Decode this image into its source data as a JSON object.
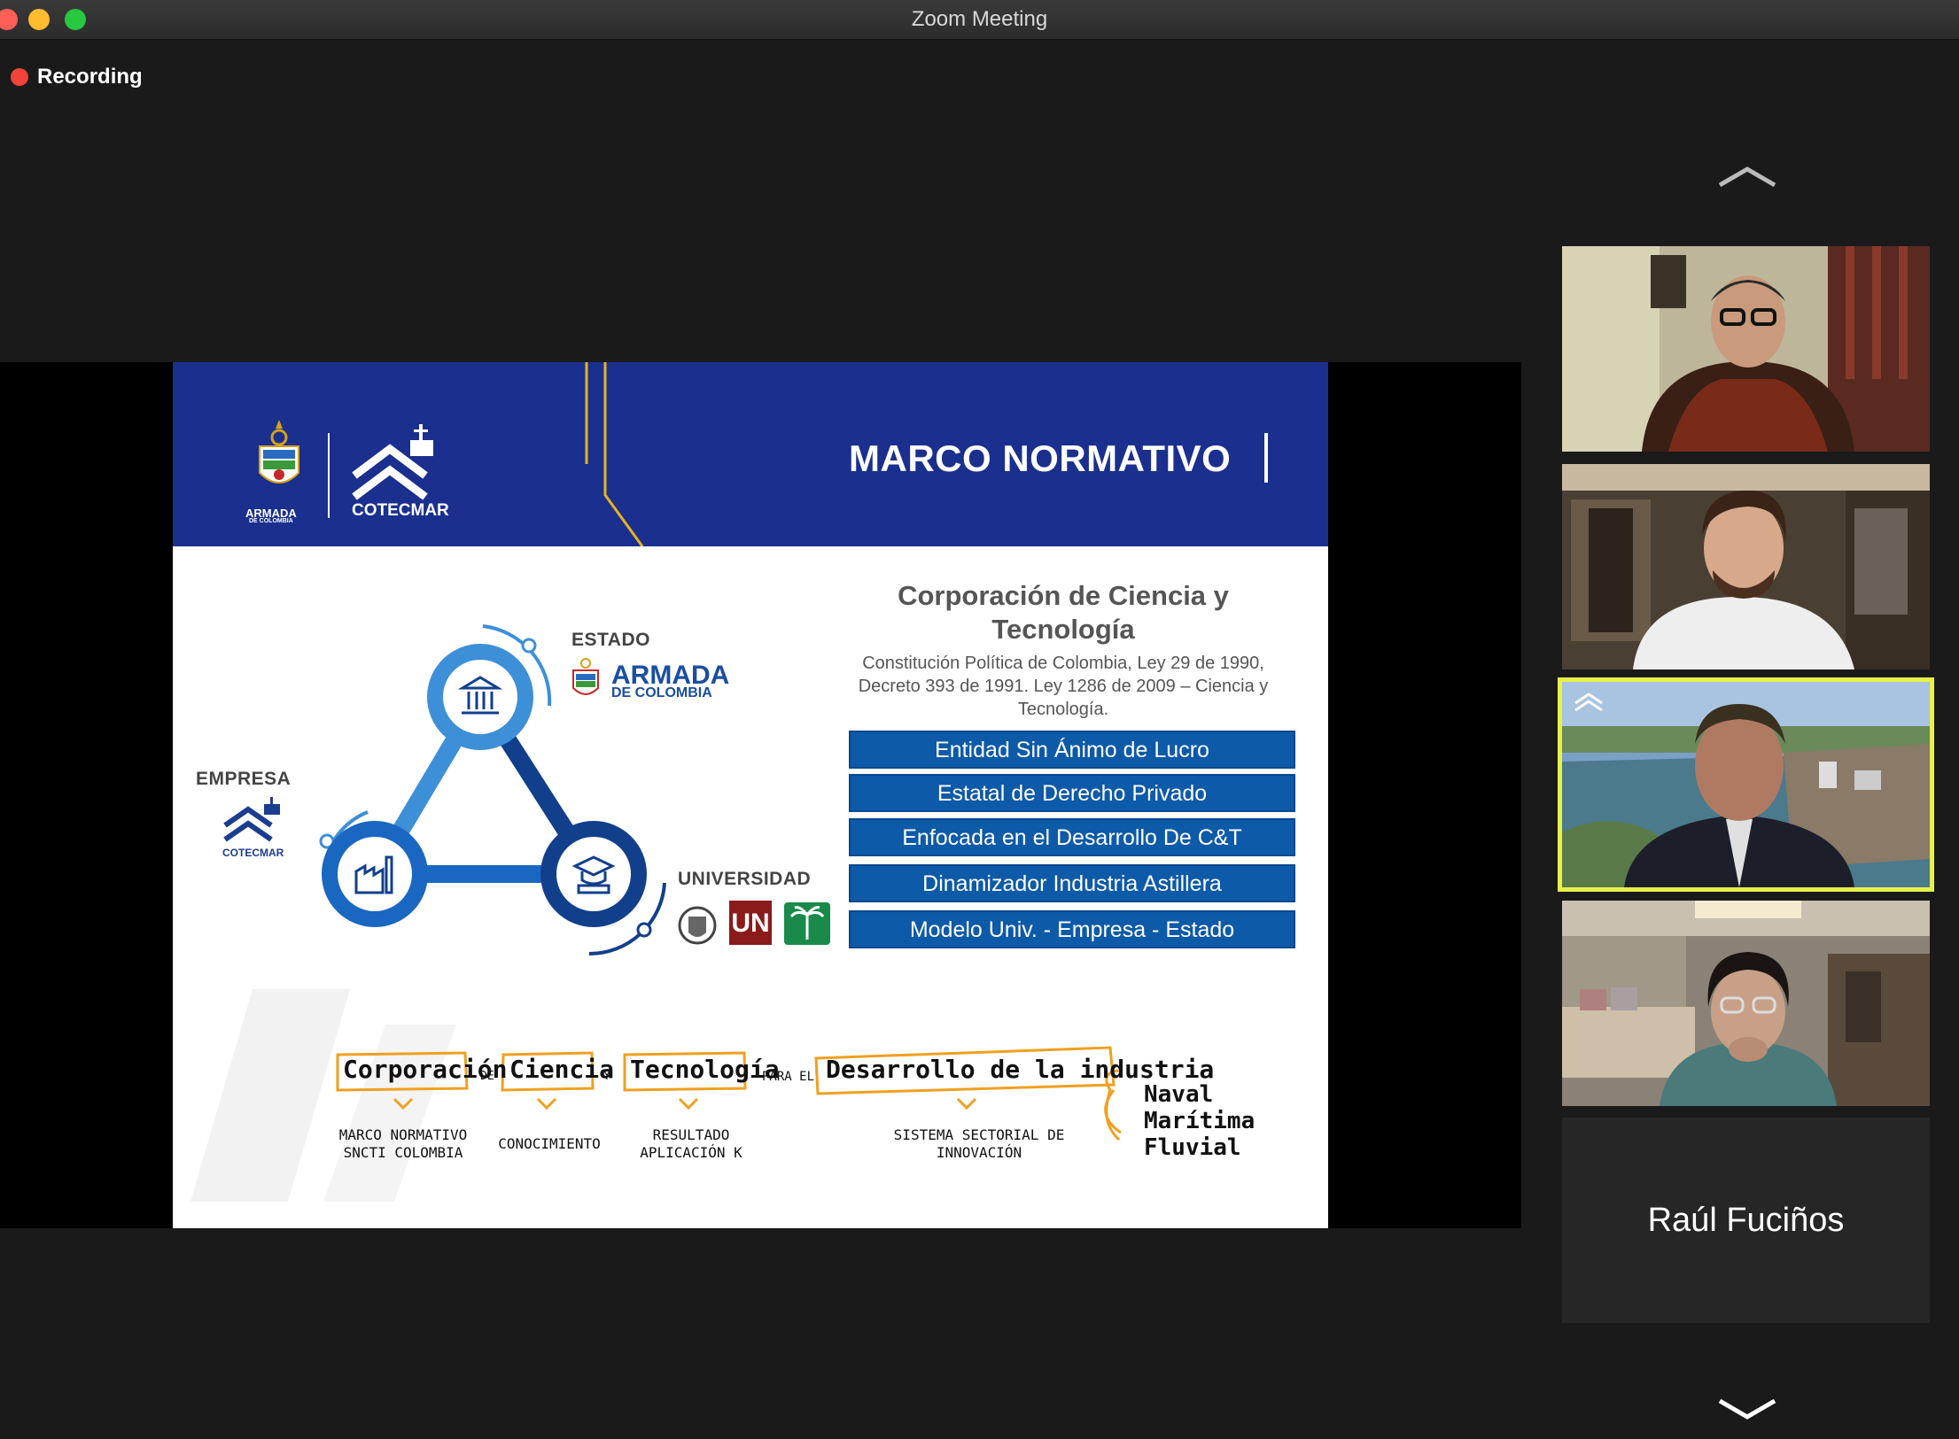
{
  "window": {
    "title": "Zoom Meeting",
    "recording_label": "Recording"
  },
  "slide": {
    "title": "MARCO NORMATIVO",
    "logos": {
      "armada_line1": "ARMADA",
      "armada_line2": "DE COLOMBIA",
      "cotecmar": "COTECMAR"
    },
    "corp_title": "Corporación de Ciencia y Tecnología",
    "corp_subtitle": "Constitución Política de Colombia, Ley 29 de 1990, Decreto 393 de 1991. Ley 1286 de 2009 – Ciencia y Tecnología.",
    "items": [
      "Entidad Sin Ánimo de Lucro",
      "Estatal de Derecho Privado",
      "Enfocada en el Desarrollo De C&T",
      "Dinamizador Industria Astillera",
      "Modelo Univ. - Empresa - Estado"
    ],
    "diagram": {
      "estado": "ESTADO",
      "empresa": "EMPRESA",
      "universidad": "UNIVERSIDAD",
      "armada_line1": "ARMADA",
      "armada_line2": "DE COLOMBIA",
      "cotecmar": "COTECMAR",
      "un": "UN"
    },
    "handwriting": {
      "corporacion": "Corporación",
      "de": "DE",
      "ciencia": "Ciencia",
      "y": "Y",
      "tecnologia": "Tecnología",
      "para_el": "PARA EL",
      "desarrollo": "Desarrollo de la industria",
      "naval": "Naval",
      "maritima": "Marítima",
      "fluvial": "Fluvial",
      "marco_line1": "MARCO NORMATIVO",
      "marco_line2": "SNCTI COLOMBIA",
      "conocimiento": "CONOCIMIENTO",
      "resultado_line1": "RESULTADO",
      "resultado_line2": "APLICACIÓN K",
      "sistema_line1": "SISTEMA SECTORIAL DE",
      "sistema_line2": "INNOVACIÓN"
    }
  },
  "participants": {
    "active_index": 2,
    "name_only": "Raúl Fuciños"
  },
  "colors": {
    "banner": "#1a2f8e",
    "pill": "#0d5aa8",
    "active_speaker": "#e6f24a",
    "recording": "#f0443a"
  }
}
